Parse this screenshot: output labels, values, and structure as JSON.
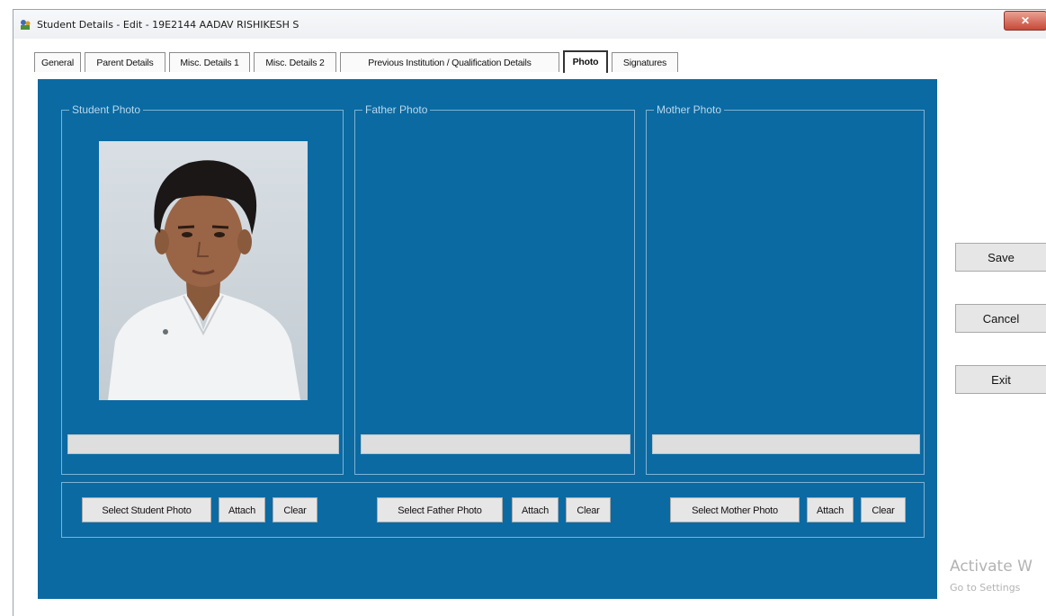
{
  "window": {
    "title": "Student Details - Edit - 19E2144 AADAV RISHIKESH S",
    "close_glyph": "✕"
  },
  "tabs": [
    {
      "label": "General"
    },
    {
      "label": "Parent Details"
    },
    {
      "label": "Misc. Details 1"
    },
    {
      "label": "Misc. Details 2"
    },
    {
      "label": "Previous Institution / Qualification Details"
    },
    {
      "label": "Photo",
      "active": true
    },
    {
      "label": "Signatures"
    }
  ],
  "groups": {
    "student": {
      "title": "Student Photo",
      "path_value": ""
    },
    "father": {
      "title": "Father Photo",
      "path_value": ""
    },
    "mother": {
      "title": "Mother Photo",
      "path_value": ""
    }
  },
  "actions": {
    "select_student": "Select Student Photo",
    "select_father": "Select Father Photo",
    "select_mother": "Select Mother Photo",
    "attach": "Attach",
    "clear": "Clear"
  },
  "side_buttons": {
    "save": "Save",
    "cancel": "Cancel",
    "exit": "Exit"
  },
  "watermark": {
    "line1": "Activate W",
    "line2": "Go to Settings"
  },
  "colors": {
    "panel": "#0b6aa2",
    "group_border": "#7fb2d4",
    "button": "#e6e6e6"
  },
  "icons": {
    "app": "app-icon",
    "close": "close-icon"
  }
}
